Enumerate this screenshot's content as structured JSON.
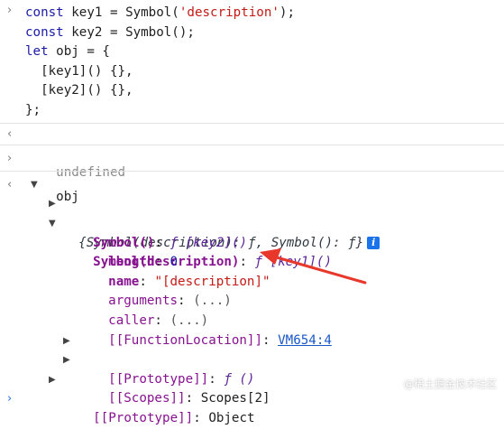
{
  "console": {
    "input1": {
      "lines": [
        {
          "parts": [
            [
              "kw",
              "const"
            ],
            [
              "t",
              " key1 = "
            ],
            [
              "t",
              "Symbol("
            ],
            [
              "str",
              "'description'"
            ],
            [
              "t",
              ");"
            ]
          ]
        },
        {
          "parts": [
            [
              "kw",
              "const"
            ],
            [
              "t",
              " key2 = "
            ],
            [
              "t",
              "Symbol();"
            ]
          ]
        },
        {
          "parts": [
            [
              "kw",
              "let"
            ],
            [
              "t",
              " obj = {"
            ]
          ]
        },
        {
          "parts": [
            [
              "t",
              "  [key1]() {},"
            ]
          ]
        },
        {
          "parts": [
            [
              "t",
              "  [key2]() {},"
            ]
          ]
        },
        {
          "parts": [
            [
              "t",
              "};"
            ]
          ]
        }
      ]
    },
    "result1": "undefined",
    "input2": "obj",
    "object": {
      "summary": "{Symbol(description): ƒ, Symbol(): ƒ}",
      "info_badge": "i",
      "props": {
        "sym2_key": "Symbol()",
        "sym2_sep": ": ",
        "sym2_f": "ƒ",
        "sym2_val": " [key2]()",
        "sym1_key": "Symbol(description)",
        "sym1_sep": ": ",
        "sym1_f": "ƒ",
        "sym1_val": " [key1]()",
        "length_key": "length",
        "length_val": "0",
        "name_key": "name",
        "name_val": "\"[description]\"",
        "arguments_key": "arguments",
        "arguments_val": "(...)",
        "caller_key": "caller",
        "caller_val": "(...)",
        "fnloc_key": "[[FunctionLocation]]",
        "fnloc_val": "VM654:4",
        "proto_key": "[[Prototype]]",
        "proto_val": "ƒ ()",
        "scopes_key": "[[Scopes]]",
        "scopes_val": "Scopes[2]",
        "objproto_key": "[[Prototype]]",
        "objproto_val": "Object"
      }
    }
  },
  "glyphs": {
    "prompt": "›",
    "result_arrow": "‹",
    "expanded": "▼",
    "collapsed": "▶"
  },
  "colors": {
    "keyword": "#1a1aa6",
    "string": "#c41a16",
    "property": "#881391",
    "link": "#1a57c8",
    "info_badge": "#1a73e8",
    "arrow": "#e8372b"
  },
  "watermark": "@稀土掘金技术社区"
}
